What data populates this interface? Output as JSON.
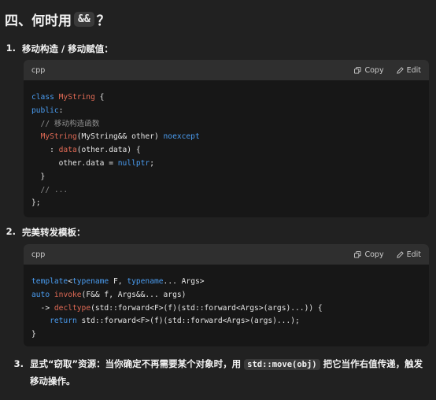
{
  "heading": {
    "prefix": "四、何时用",
    "chip": "&&",
    "suffix": "？"
  },
  "items": [
    {
      "num": "1.",
      "title": "移动构造 / 移动赋值："
    },
    {
      "num": "2.",
      "title": "完美转发模板："
    }
  ],
  "code_blocks": [
    {
      "lang": "cpp",
      "copy_label": "Copy",
      "edit_label": "Edit",
      "lines": [
        [
          {
            "t": "class ",
            "c": "kw"
          },
          {
            "t": "MyString",
            "c": "fn"
          },
          {
            "t": " {",
            "c": ""
          }
        ],
        [
          {
            "t": "public",
            "c": "kw"
          },
          {
            "t": ":",
            "c": ""
          }
        ],
        [
          {
            "t": "  // 移动构造函数",
            "c": "cm"
          }
        ],
        [
          {
            "t": "  ",
            "c": ""
          },
          {
            "t": "MyString",
            "c": "fn"
          },
          {
            "t": "(MyString&& other) ",
            "c": ""
          },
          {
            "t": "noexcept",
            "c": "kw"
          }
        ],
        [
          {
            "t": "    : ",
            "c": ""
          },
          {
            "t": "data",
            "c": "fn"
          },
          {
            "t": "(other.data) {",
            "c": ""
          }
        ],
        [
          {
            "t": "      other.data = ",
            "c": ""
          },
          {
            "t": "nullptr",
            "c": "kw"
          },
          {
            "t": ";",
            "c": ""
          }
        ],
        [
          {
            "t": "  }",
            "c": ""
          }
        ],
        [
          {
            "t": "  // ...",
            "c": "cm"
          }
        ],
        [
          {
            "t": "};",
            "c": ""
          }
        ]
      ]
    },
    {
      "lang": "cpp",
      "copy_label": "Copy",
      "edit_label": "Edit",
      "lines": [
        [
          {
            "t": "template",
            "c": "kw"
          },
          {
            "t": "<",
            "c": ""
          },
          {
            "t": "typename",
            "c": "kw"
          },
          {
            "t": " F, ",
            "c": ""
          },
          {
            "t": "typename",
            "c": "kw"
          },
          {
            "t": "... Args>",
            "c": ""
          }
        ],
        [
          {
            "t": "auto ",
            "c": "kw"
          },
          {
            "t": "invoke",
            "c": "fn"
          },
          {
            "t": "(F&& f, Args&&... args)",
            "c": ""
          }
        ],
        [
          {
            "t": "  -> ",
            "c": ""
          },
          {
            "t": "decltype",
            "c": "fn"
          },
          {
            "t": "(std::forward<F>(f)(std::forward<Args>(args)...)) {",
            "c": ""
          }
        ],
        [
          {
            "t": "    ",
            "c": ""
          },
          {
            "t": "return",
            "c": "kw"
          },
          {
            "t": " std::forward<F>(f)(std::forward<Args>(args)...);",
            "c": ""
          }
        ],
        [
          {
            "t": "}",
            "c": ""
          }
        ]
      ]
    }
  ],
  "item3": {
    "num": "3.",
    "before": "显式“窃取”资源：当你确定不再需要某个对象时，用 ",
    "chip": "std::move(obj)",
    "after": " 把它当作右值传递，触发移动操作。"
  },
  "colors": {
    "background": "#212121",
    "code_bg": "#171717",
    "code_header": "#2f2f2f",
    "keyword": "#4a9cf0",
    "function": "#e06a55",
    "comment": "#8e8e8e"
  }
}
